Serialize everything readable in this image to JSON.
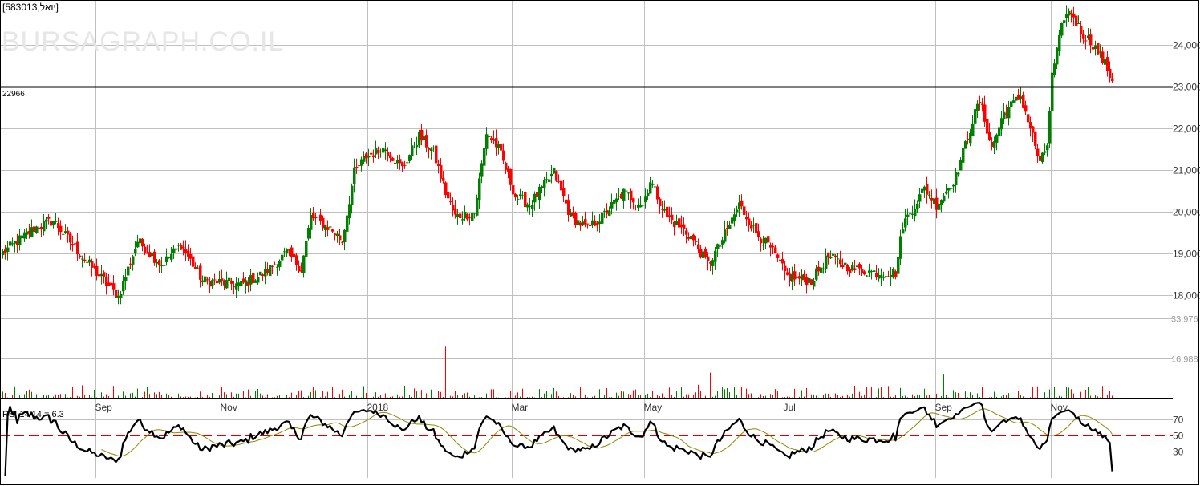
{
  "header": {
    "symbol_label": "[583013,יואל]",
    "watermark": "BURSAGRAPH.CO.IL",
    "last_price_label": "22966"
  },
  "colors": {
    "up": "#008000",
    "down": "#ff0000",
    "grid": "#c0c0c0",
    "rsi": "#000000",
    "rsi_ma": "#8b8b00",
    "rsi_mid": "#dd0000"
  },
  "chart_data": [
    {
      "type": "candlestick",
      "title": "Price",
      "y_ticks": [
        "18,000",
        "19,000",
        "20,000",
        "21,000",
        "22,000",
        "23,000",
        "24,000"
      ],
      "y_tick_values": [
        18000,
        19000,
        20000,
        21000,
        22000,
        23000,
        24000
      ],
      "x_ticks": [
        "Sep",
        "Nov",
        "2018",
        "Mar",
        "May",
        "Jul",
        "Sep",
        "Nov"
      ],
      "x_tick_days": [
        39,
        91,
        152,
        212,
        267,
        325,
        388,
        436
      ],
      "total_days": 462,
      "close_path": [
        [
          0,
          19020
        ],
        [
          13,
          19600
        ],
        [
          21,
          19790
        ],
        [
          33,
          18920
        ],
        [
          48,
          17960
        ],
        [
          56,
          19300
        ],
        [
          66,
          18730
        ],
        [
          74,
          19210
        ],
        [
          83,
          18350
        ],
        [
          99,
          18250
        ],
        [
          109,
          18540
        ],
        [
          118,
          19020
        ],
        [
          124,
          18630
        ],
        [
          128,
          19880
        ],
        [
          136,
          19600
        ],
        [
          141,
          19300
        ],
        [
          146,
          20940
        ],
        [
          151,
          21330
        ],
        [
          159,
          21520
        ],
        [
          166,
          21040
        ],
        [
          173,
          21810
        ],
        [
          179,
          21420
        ],
        [
          184,
          20460
        ],
        [
          188,
          19880
        ],
        [
          196,
          19980
        ],
        [
          201,
          21900
        ],
        [
          206,
          21520
        ],
        [
          213,
          20370
        ],
        [
          219,
          20170
        ],
        [
          229,
          20940
        ],
        [
          236,
          19880
        ],
        [
          243,
          19600
        ],
        [
          249,
          19880
        ],
        [
          258,
          20460
        ],
        [
          266,
          20170
        ],
        [
          269,
          20750
        ],
        [
          276,
          19880
        ],
        [
          286,
          19400
        ],
        [
          293,
          18730
        ],
        [
          298,
          19210
        ],
        [
          306,
          20170
        ],
        [
          313,
          19500
        ],
        [
          319,
          19120
        ],
        [
          326,
          18440
        ],
        [
          336,
          18350
        ],
        [
          343,
          18920
        ],
        [
          353,
          18630
        ],
        [
          363,
          18540
        ],
        [
          371,
          18540
        ],
        [
          374,
          19690
        ],
        [
          383,
          20560
        ],
        [
          388,
          20170
        ],
        [
          396,
          20840
        ],
        [
          403,
          22190
        ],
        [
          406,
          22670
        ],
        [
          411,
          21520
        ],
        [
          416,
          22380
        ],
        [
          423,
          22770
        ],
        [
          428,
          21810
        ],
        [
          431,
          21130
        ],
        [
          434,
          21620
        ],
        [
          436,
          23250
        ],
        [
          441,
          24690
        ],
        [
          444,
          24790
        ],
        [
          448,
          24310
        ],
        [
          453,
          24020
        ],
        [
          458,
          23540
        ],
        [
          461,
          23150
        ]
      ]
    },
    {
      "type": "bar",
      "title": "Volume",
      "y_ticks": [
        "16,988",
        "33,976"
      ],
      "y_tick_values": [
        16988,
        33976
      ],
      "spikes": [
        [
          184,
          22000
        ],
        [
          294,
          11000
        ],
        [
          391,
          10500
        ],
        [
          399,
          9000
        ],
        [
          436,
          33976
        ]
      ]
    },
    {
      "type": "line",
      "title": "RSI 14/14 = 6.3",
      "y_ticks": [
        "30",
        "50",
        "70"
      ],
      "y_tick_values": [
        30,
        50,
        70
      ],
      "ylim": [
        0,
        100
      ],
      "last_value": 6.3
    }
  ]
}
